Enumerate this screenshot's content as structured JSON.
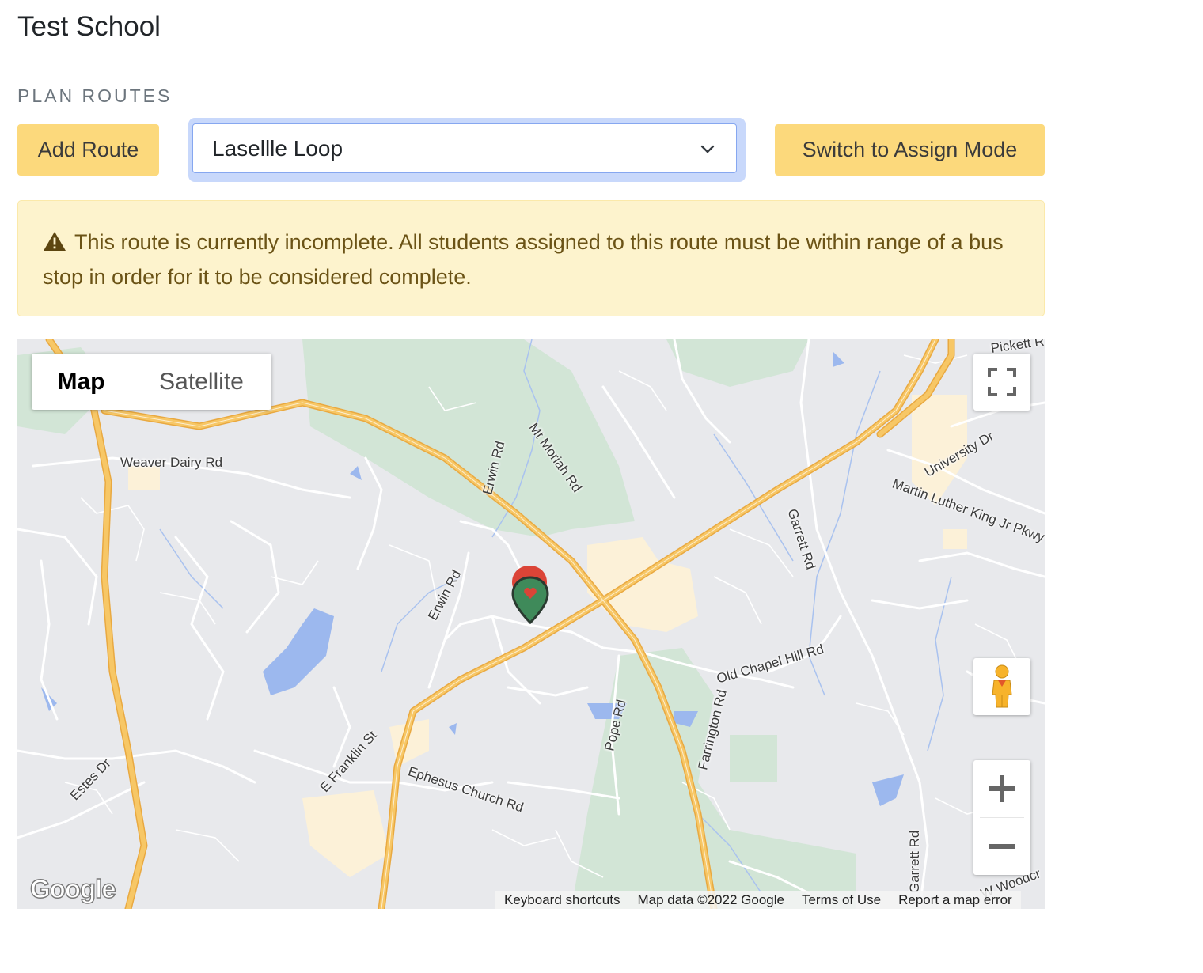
{
  "page": {
    "title": "Test School",
    "section_label": "PLAN ROUTES"
  },
  "toolbar": {
    "add_route_label": "Add Route",
    "selected_route": "Lasellle Loop",
    "assign_mode_label": "Switch to Assign Mode"
  },
  "alert": {
    "message": "This route is currently incomplete. All students assigned to this route must be within range of a bus stop in order for it to be considered complete.",
    "icon": "warning-triangle-icon"
  },
  "map": {
    "type_options": [
      "Map",
      "Satellite"
    ],
    "selected_type": "Map",
    "street_labels": {
      "weaver_dairy": "Weaver Dairy Rd",
      "erwin_north": "Erwin Rd",
      "mt_moriah": "Mt Moriah Rd",
      "university": "University Dr",
      "mlk": "Martin Luther King Jr Pkwy",
      "garrett_north": "Garrett Rd",
      "erwin_mid": "Erwin Rd",
      "old_chapel": "Old Chapel Hill Rd",
      "farrington": "Farrington Rd",
      "pope": "Pope Rd",
      "franklin": "E Franklin St",
      "ephesus": "Ephesus Church Rd",
      "estes": "Estes Dr",
      "garrett_south": "Garrett Rd",
      "pickett": "Pickett R",
      "woodcroft": "W Woodcr"
    },
    "attribution": {
      "keyboard": "Keyboard shortcuts",
      "data": "Map data ©2022 Google",
      "terms": "Terms of Use",
      "report": "Report a map error"
    },
    "logo_text": "Google",
    "colors": {
      "highway": "#f6c35b",
      "water": "#9cb8ee",
      "park": "#d2e5d6",
      "land": "#e8e9ec",
      "marker_green": "#3f8a5a",
      "marker_red": "#db4437"
    }
  }
}
